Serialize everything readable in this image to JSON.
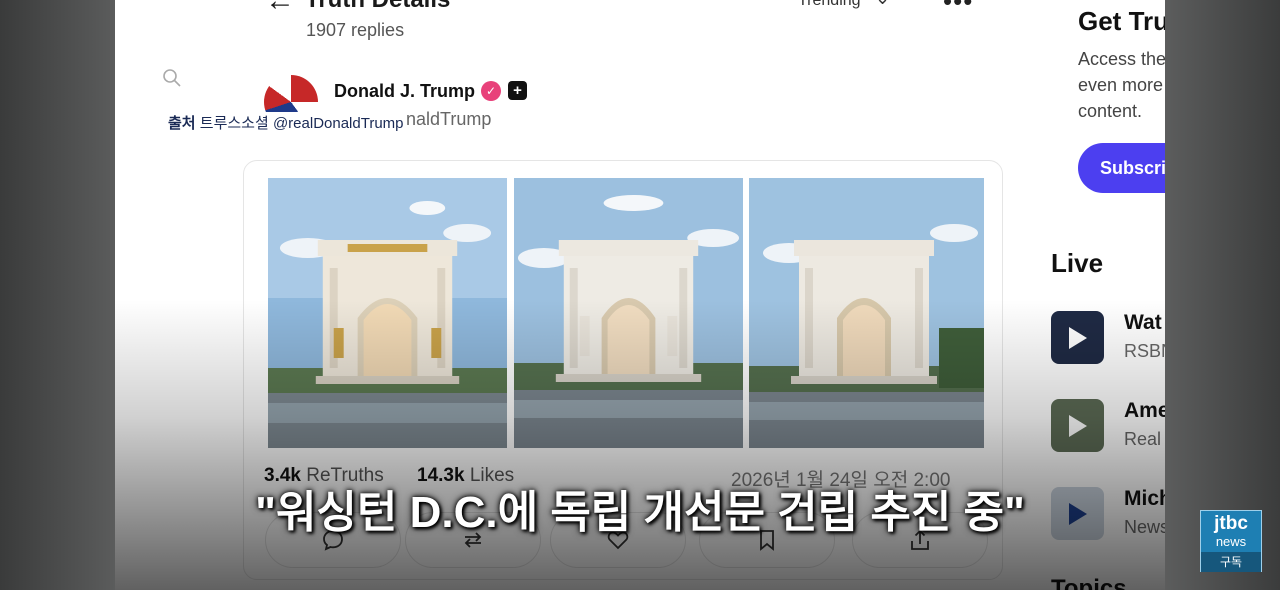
{
  "header": {
    "title": "Truth Details",
    "reply_count": "1907 replies",
    "sort_label": "Trending"
  },
  "post": {
    "author_name": "Donald J. Trump",
    "handle_partial": "naldTrump",
    "source_prefix": "출처",
    "source_text": "트루스소셜 @realDonaldTrump",
    "retruths_count": "3.4k",
    "retruths_label": "ReTruths",
    "likes_count": "14.3k",
    "likes_label": "Likes",
    "timestamp": "2026년 1월 24일 오전 2:00"
  },
  "promo": {
    "title": "Get Tru",
    "body": "Access the\neven more\ncontent.",
    "button_label": "Subscribe"
  },
  "live": {
    "title": "Live",
    "items": [
      {
        "name": "Wat",
        "sub": "RSBN"
      },
      {
        "name": "Ame",
        "sub": "Real"
      },
      {
        "name": "Mich",
        "sub": "News"
      }
    ]
  },
  "topics_title": "Topics",
  "subtitle": "\"워싱턴 D.C.에 독립 개선문 건립 추진 중\"",
  "broadcaster": {
    "logo_text": "jtbc",
    "logo_sub": "news",
    "subscribe": "구독"
  },
  "colors": {
    "subscribe_button": "#4c3ff0",
    "verified_badge": "#e8417a",
    "jtbc_blue": "#1e7fb3"
  }
}
